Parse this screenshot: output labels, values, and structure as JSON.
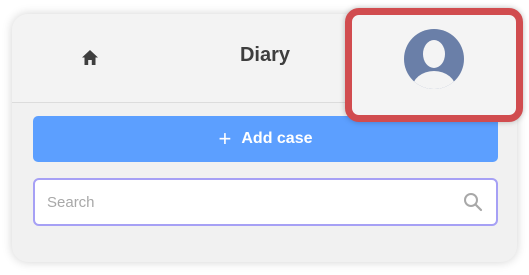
{
  "header": {
    "home_icon": "home-icon",
    "title": "Diary",
    "avatar_icon": "user-avatar-icon"
  },
  "actions": {
    "add_case_icon": "plus-icon",
    "add_case_label": "Add case"
  },
  "search": {
    "placeholder": "Search",
    "value": "",
    "icon": "search-icon"
  },
  "colors": {
    "primary_button": "#5c9fff",
    "highlight_border": "#d14c4f",
    "search_border": "#a6a0f5",
    "avatar": "#6a7fa8"
  }
}
